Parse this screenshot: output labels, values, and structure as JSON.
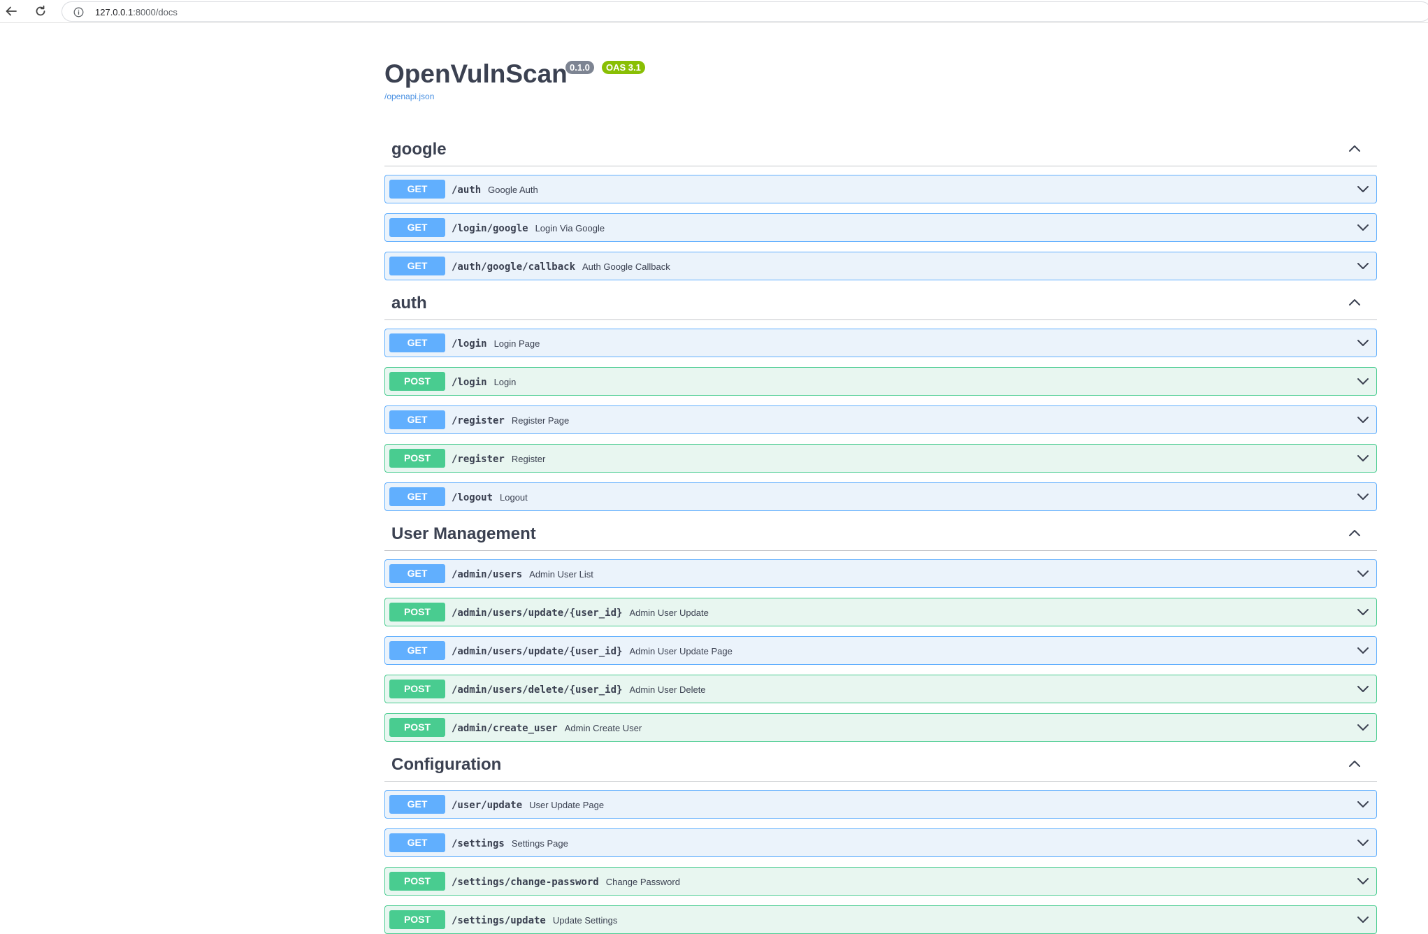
{
  "browser": {
    "url_host": "127.0.0.1",
    "url_path": ":8000/docs"
  },
  "api": {
    "title": "OpenVulnScan",
    "version": "0.1.0",
    "oas_version": "OAS 3.1",
    "spec_link": "/openapi.json"
  },
  "tags": [
    {
      "name": "google",
      "operations": [
        {
          "method": "GET",
          "path": "/auth",
          "summary": "Google Auth"
        },
        {
          "method": "GET",
          "path": "/login/google",
          "summary": "Login Via Google"
        },
        {
          "method": "GET",
          "path": "/auth/google/callback",
          "summary": "Auth Google Callback"
        }
      ]
    },
    {
      "name": "auth",
      "operations": [
        {
          "method": "GET",
          "path": "/login",
          "summary": "Login Page"
        },
        {
          "method": "POST",
          "path": "/login",
          "summary": "Login"
        },
        {
          "method": "GET",
          "path": "/register",
          "summary": "Register Page"
        },
        {
          "method": "POST",
          "path": "/register",
          "summary": "Register"
        },
        {
          "method": "GET",
          "path": "/logout",
          "summary": "Logout"
        }
      ]
    },
    {
      "name": "User Management",
      "operations": [
        {
          "method": "GET",
          "path": "/admin/users",
          "summary": "Admin User List"
        },
        {
          "method": "POST",
          "path": "/admin/users/update/{user_id}",
          "summary": "Admin User Update"
        },
        {
          "method": "GET",
          "path": "/admin/users/update/{user_id}",
          "summary": "Admin User Update Page"
        },
        {
          "method": "POST",
          "path": "/admin/users/delete/{user_id}",
          "summary": "Admin User Delete"
        },
        {
          "method": "POST",
          "path": "/admin/create_user",
          "summary": "Admin Create User"
        }
      ]
    },
    {
      "name": "Configuration",
      "operations": [
        {
          "method": "GET",
          "path": "/user/update",
          "summary": "User Update Page"
        },
        {
          "method": "GET",
          "path": "/settings",
          "summary": "Settings Page"
        },
        {
          "method": "POST",
          "path": "/settings/change-password",
          "summary": "Change Password"
        },
        {
          "method": "POST",
          "path": "/settings/update",
          "summary": "Update Settings"
        }
      ]
    }
  ],
  "colors": {
    "get": "#61affe",
    "post": "#49cc90",
    "get_bg": "#ebf3fb",
    "post_bg": "#e8f6f0",
    "text": "#3b4151",
    "version_badge": "#7d8492",
    "oas_badge": "#89bf04",
    "link": "#4990e2"
  }
}
